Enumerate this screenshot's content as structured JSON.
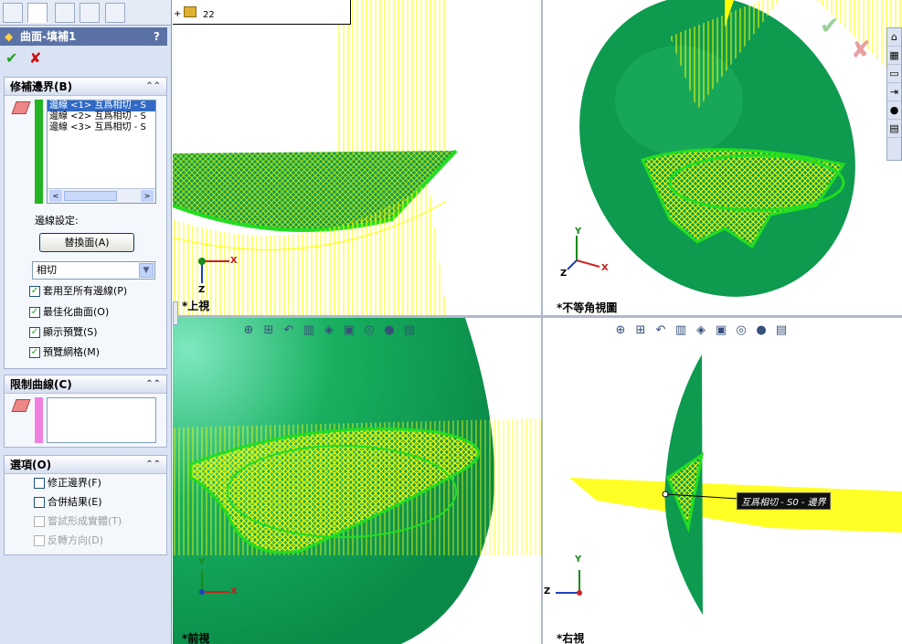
{
  "feature_title": "曲面-填補1",
  "help_label": "?",
  "ok_label": "✔",
  "cancel_label": "✘",
  "patch_boundary": {
    "header": "修補邊界(B)",
    "items": [
      "邊線 <1> 互爲相切 - S",
      "邊線 <2> 互爲相切 - S",
      "邊線 <3> 互爲相切 - S"
    ],
    "edge_settings_label": "邊線設定:",
    "replace_button": "替換面(A)",
    "condition_value": "相切",
    "checks": [
      {
        "label": "套用至所有邊線(P)",
        "checked": true
      },
      {
        "label": "最佳化曲面(O)",
        "checked": true
      },
      {
        "label": "顯示預覽(S)",
        "checked": true
      },
      {
        "label": "預覽網格(M)",
        "checked": true
      }
    ]
  },
  "constraint_curves": {
    "header": "限制曲線(C)"
  },
  "options": {
    "header": "選項(O)",
    "checks": [
      {
        "label": "修正邊界(F)",
        "enabled": true
      },
      {
        "label": "合併結果(E)",
        "enabled": true
      },
      {
        "label": "嘗試形成實體(T)",
        "enabled": false
      },
      {
        "label": "反轉方向(D)",
        "enabled": false
      }
    ]
  },
  "tree_popup": {
    "item": "22"
  },
  "viewports": {
    "top": "*上視",
    "iso": "*不等角視圖",
    "front": "*前視",
    "right": "*右視"
  },
  "triad": {
    "x": "X",
    "y": "Y",
    "z": "Z"
  },
  "tooltip": "互爲相切 - S0 - 邊界",
  "colors": {
    "surface": "#0e9a4f",
    "mesh": "#ffff00",
    "edge": "#22dd22",
    "panel": "#d9e3f3",
    "title_bar": "#5a72a6"
  }
}
